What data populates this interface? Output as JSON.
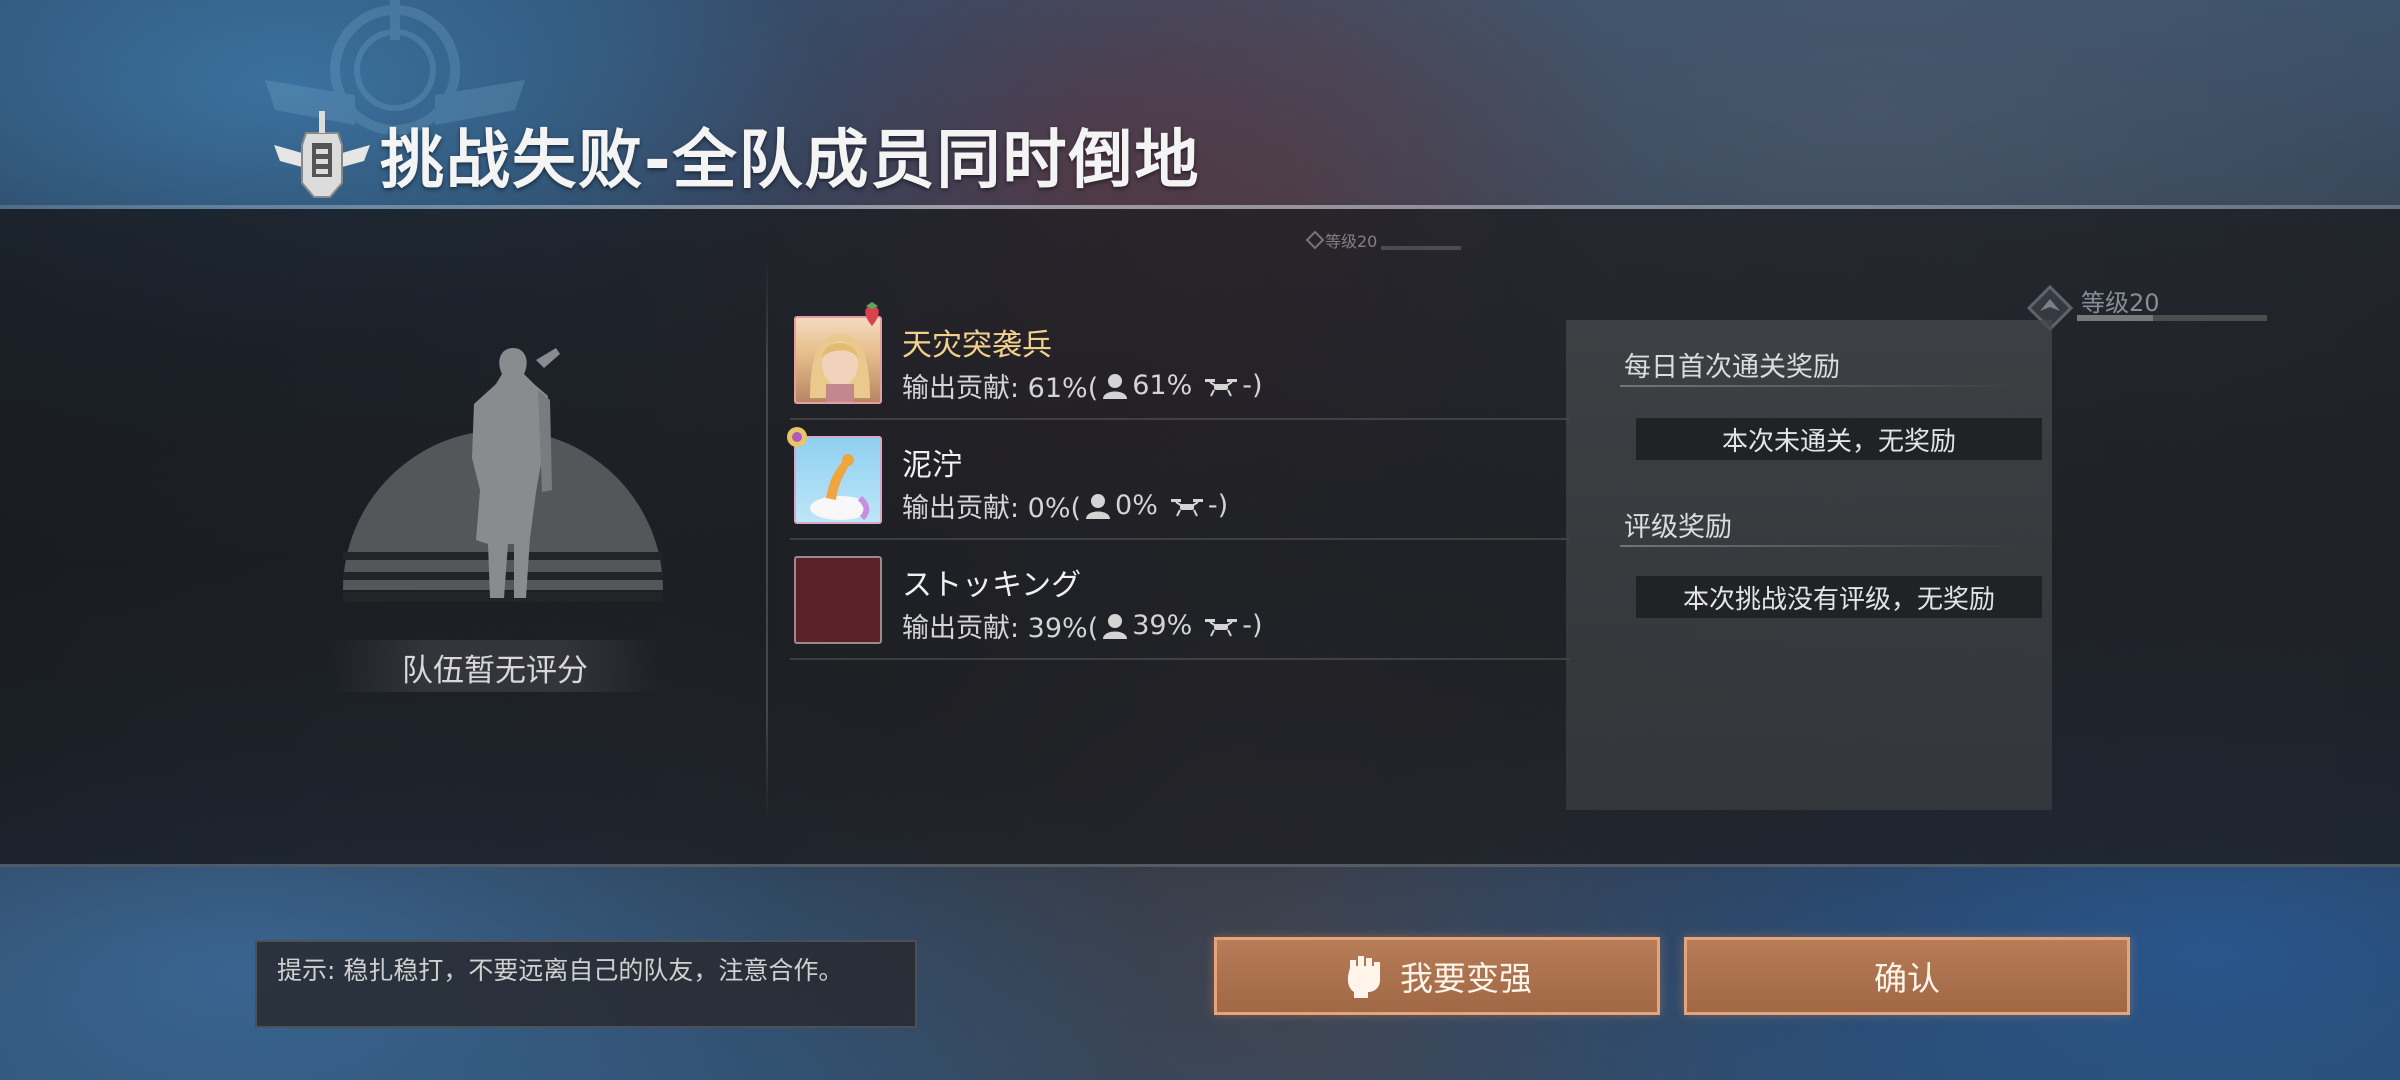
{
  "title": "挑战失败-全队成员同时倒地",
  "team_rating": {
    "label": "队伍暂无评分"
  },
  "members": [
    {
      "name": "天灾突袭兵",
      "name_color": "#f2d28a",
      "stats_prefix": "输出贡献: 61%(",
      "player_pct": "61%",
      "drone_value": "-)"
    },
    {
      "name": "泥泞",
      "name_color": "#f0f0f0",
      "stats_prefix": "输出贡献: 0%(",
      "player_pct": "0%",
      "drone_value": "-)"
    },
    {
      "name": "ストッキング",
      "name_color": "#f0f0f0",
      "stats_prefix": "输出贡献: 39%(",
      "player_pct": "39%",
      "drone_value": "-)"
    }
  ],
  "rank_small": "等级20",
  "rank_large": "等级20",
  "rewards": {
    "daily_heading": "每日首次通关奖励",
    "daily_text": "本次未通关，无奖励",
    "rating_heading": "评级奖励",
    "rating_text": "本次挑战没有评级，无奖励"
  },
  "tip": "提示: 稳扎稳打，不要远离自己的队友，注意合作。",
  "buttons": {
    "strengthen": "我要变强",
    "confirm": "确认"
  },
  "colors": {
    "accent_button": "#b77c58",
    "button_border": "#e6a478",
    "gold_name": "#f2d28a"
  }
}
